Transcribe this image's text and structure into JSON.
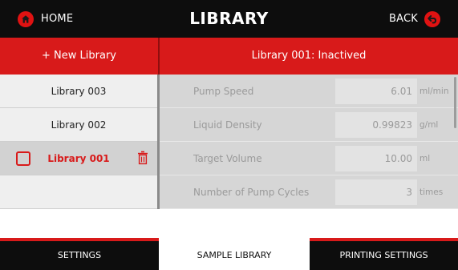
{
  "header": {
    "home_label": "HOME",
    "title": "LIBRARY",
    "back_label": "BACK",
    "home_icon": "home-icon",
    "back_icon": "back-arrow-icon"
  },
  "toolbar": {
    "new_library_label": "+ New Library",
    "library_status": "Library 001: Inactived"
  },
  "libraries": [
    {
      "name": "Library 003",
      "selected": false
    },
    {
      "name": "Library 002",
      "selected": false
    },
    {
      "name": "Library 001",
      "selected": true
    },
    {
      "name": "",
      "selected": false
    }
  ],
  "parameters": [
    {
      "label": "Pump Speed",
      "value": "6.01",
      "unit": "ml/min"
    },
    {
      "label": "Liquid Density",
      "value": "0.99823",
      "unit": "g/ml"
    },
    {
      "label": "Target Volume",
      "value": "10.00",
      "unit": "ml"
    },
    {
      "label": "Number of Pump Cycles",
      "value": "3",
      "unit": "times"
    }
  ],
  "bottom_nav": {
    "tabs": [
      {
        "label": "SETTINGS",
        "active": false
      },
      {
        "label": "SAMPLE LIBRARY",
        "active": true
      },
      {
        "label": "PRINTING SETTINGS",
        "active": false
      }
    ]
  },
  "colors": {
    "accent": "#d81a1a",
    "header_bg": "#0d0d0d",
    "panel_bg": "#d6d6d6",
    "list_bg": "#efefef"
  }
}
